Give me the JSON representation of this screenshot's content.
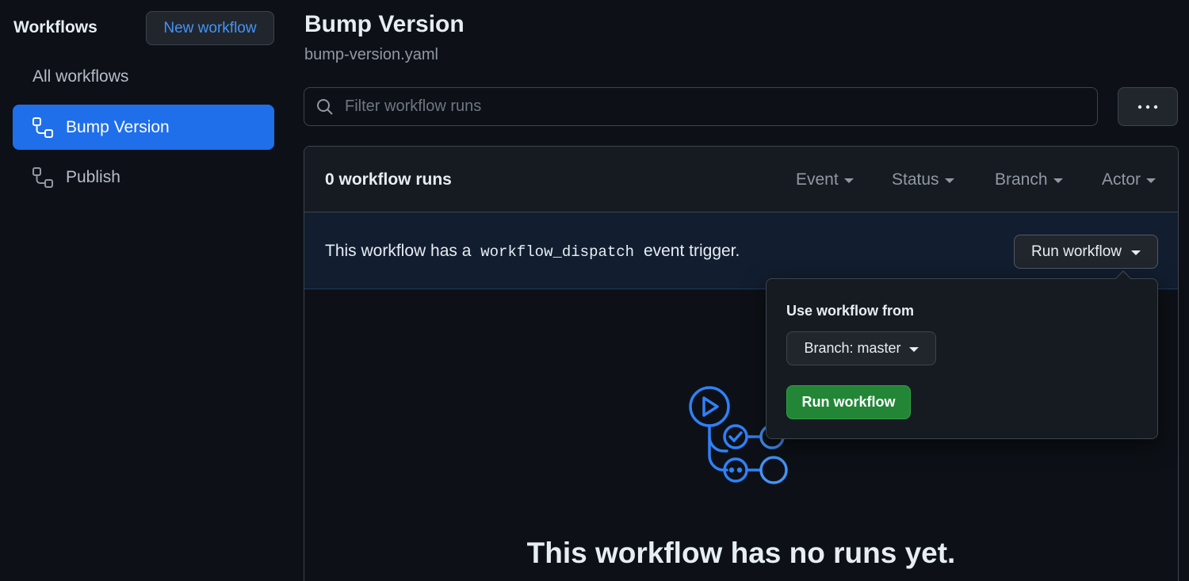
{
  "sidebar": {
    "title": "Workflows",
    "new_button": "New workflow",
    "all_label": "All workflows",
    "items": [
      {
        "label": "Bump Version",
        "icon": "workflow-icon",
        "active": true
      },
      {
        "label": "Publish",
        "icon": "workflow-icon",
        "active": false
      }
    ]
  },
  "header": {
    "title": "Bump Version",
    "filename": "bump-version.yaml"
  },
  "search": {
    "placeholder": "Filter workflow runs",
    "icon": "search-icon"
  },
  "more_button": {
    "icon": "kebab-horizontal-icon"
  },
  "runs": {
    "count_label": "0 workflow runs",
    "filters": [
      "Event",
      "Status",
      "Branch",
      "Actor"
    ]
  },
  "dispatch": {
    "prefix": "This workflow has a",
    "code": "workflow_dispatch",
    "suffix": "event trigger.",
    "button": "Run workflow"
  },
  "popover": {
    "label": "Use workflow from",
    "branch_button": "Branch: master",
    "run_button": "Run workflow"
  },
  "empty": {
    "title": "This workflow has no runs yet."
  },
  "colors": {
    "background": "#0d1117",
    "accent": "#1f6feb",
    "link": "#4493f8",
    "success": "#238636"
  }
}
